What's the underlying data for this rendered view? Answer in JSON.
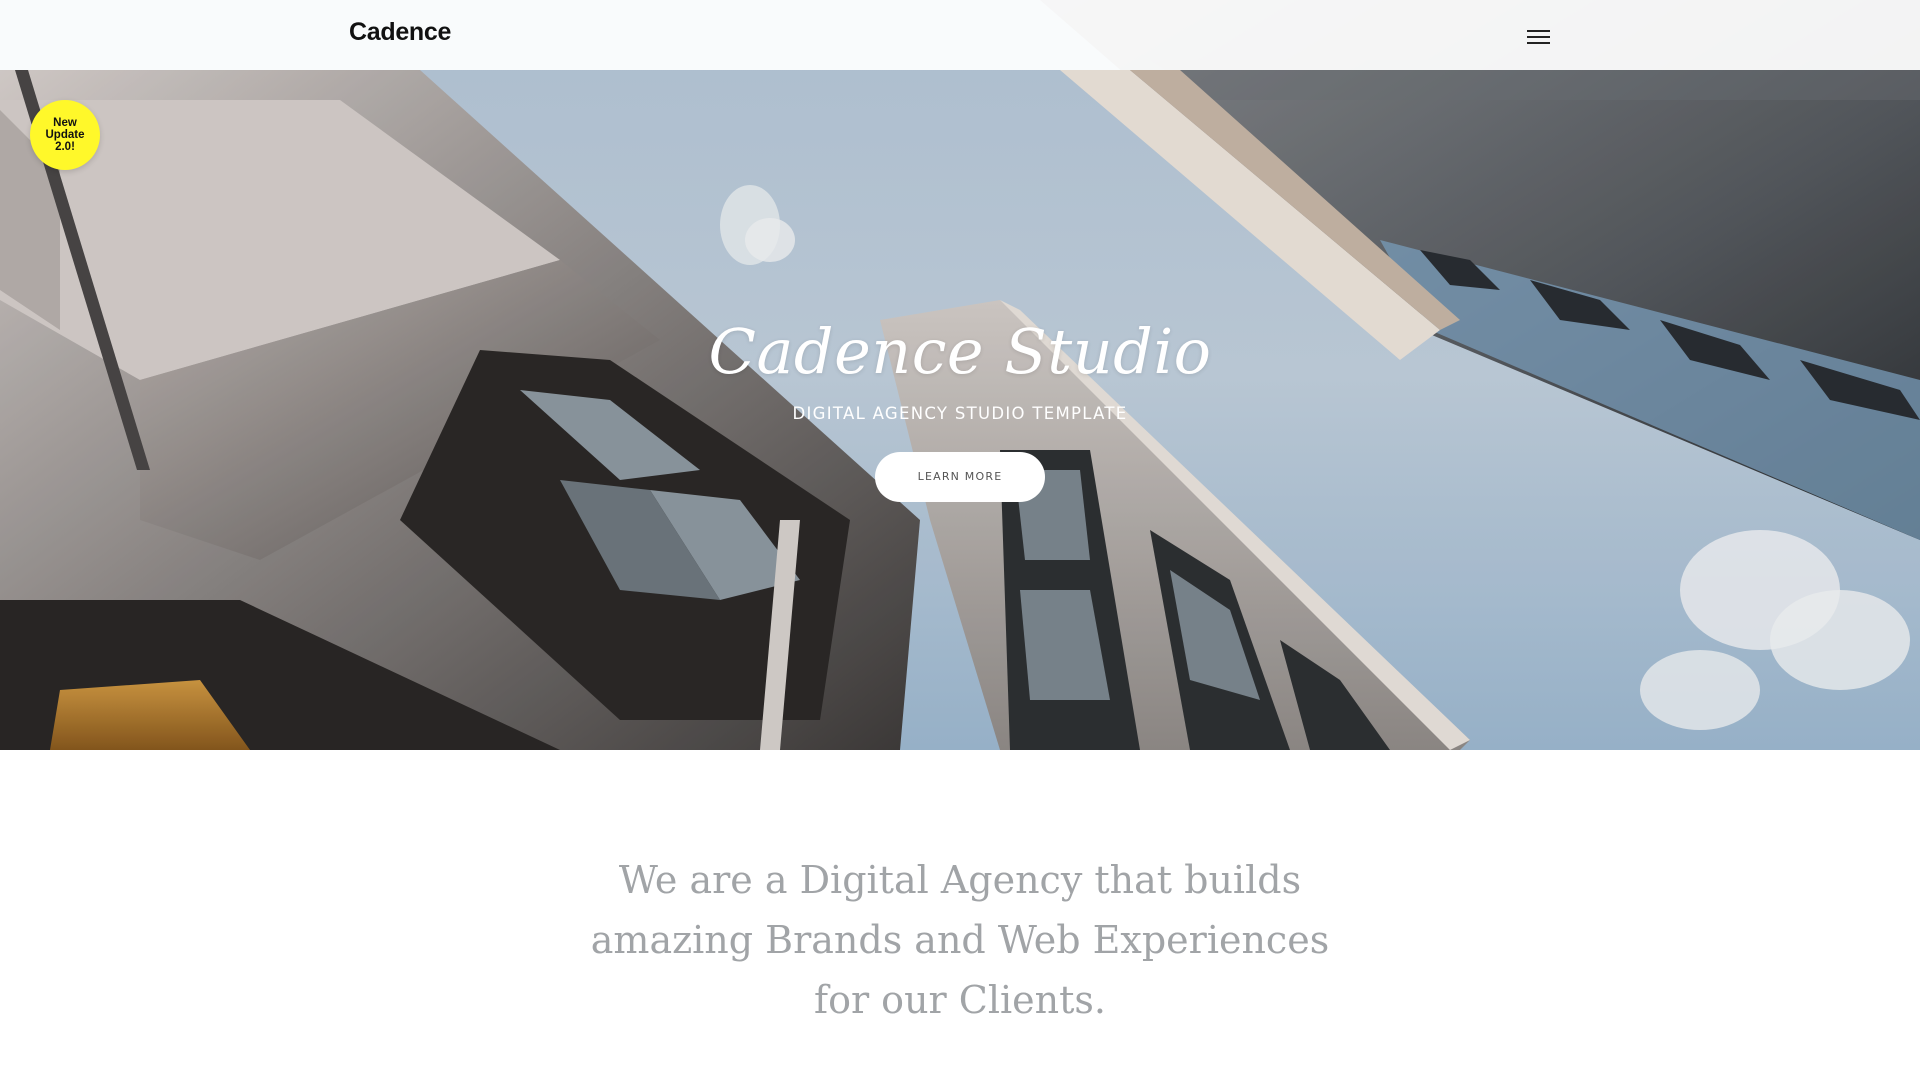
{
  "header": {
    "brand": "Cadence",
    "menu_icon": "hamburger-menu-icon"
  },
  "badge": {
    "lines": [
      "New",
      "Update",
      "2.0!"
    ],
    "color": "#fff82a"
  },
  "hero": {
    "title": "Cadence Studio",
    "subtitle": "DIGITAL AGENCY STUDIO TEMPLATE",
    "button_label": "LEARN MORE",
    "background": "photo of buildings viewed from below against blue sky"
  },
  "intro": {
    "text": "We are a Digital Agency that builds amazing Brands and Web Experiences for our Clients."
  },
  "colors": {
    "intro_text": "#a1a4a7",
    "sky": "#aec2d6",
    "header_bg": "#ffffff"
  }
}
